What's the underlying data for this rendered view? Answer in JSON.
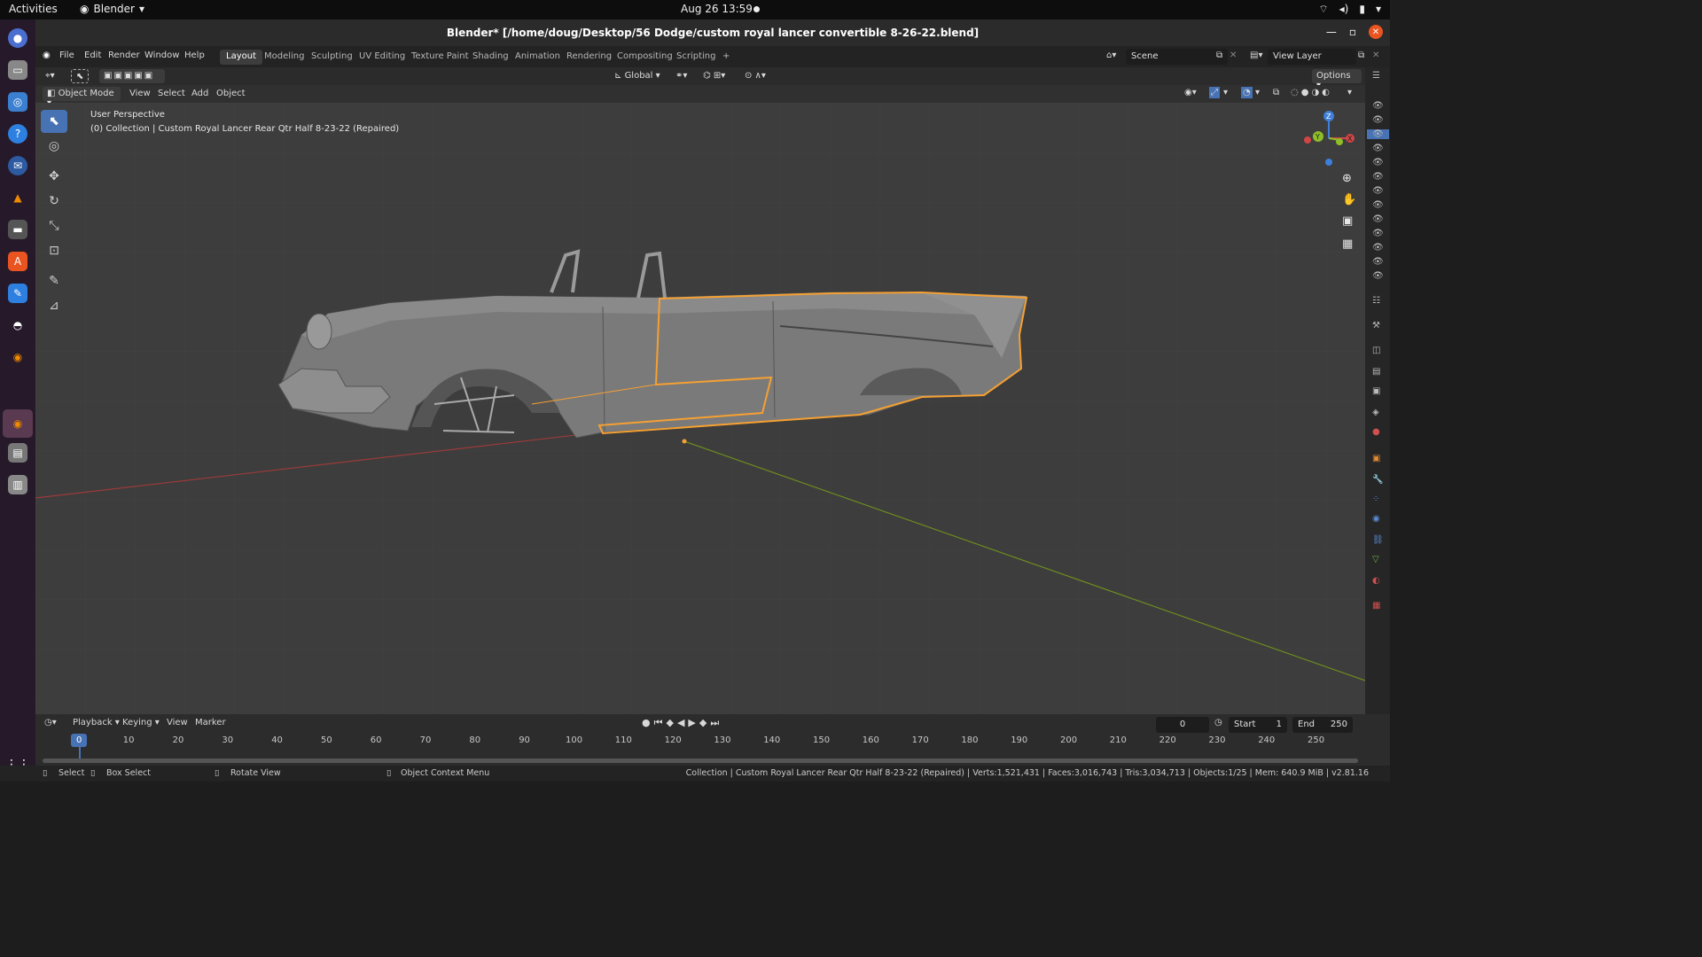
{
  "system_bar": {
    "activities": "Activities",
    "app_name": "Blender",
    "clock": "Aug 26  13:59"
  },
  "title": "Blender* [/home/doug/Desktop/56 Dodge/custom royal lancer convertible 8-26-22.blend]",
  "menu": [
    "File",
    "Edit",
    "Render",
    "Window",
    "Help"
  ],
  "workspaces": [
    "Layout",
    "Modeling",
    "Sculpting",
    "UV Editing",
    "Texture Paint",
    "Shading",
    "Animation",
    "Rendering",
    "Compositing",
    "Scripting"
  ],
  "active_workspace": "Layout",
  "scene": "Scene",
  "view_layer": "View Layer",
  "tool_header": {
    "transform_orientation": "Global",
    "options": "Options"
  },
  "viewport_header": {
    "mode": "Object Mode",
    "menus": [
      "View",
      "Select",
      "Add",
      "Object"
    ]
  },
  "viewport_overlay": {
    "perspective": "User Perspective",
    "collection": "(0) Collection | Custom Royal Lancer  Rear Qtr  Half 8-23-22 (Repaired)"
  },
  "gizmo": {
    "z": "Z",
    "y": "Y",
    "x": "X"
  },
  "timeline": {
    "menus": [
      "Playback",
      "Keying",
      "View",
      "Marker"
    ],
    "current_frame": "0",
    "start_label": "Start",
    "start": "1",
    "end_label": "End",
    "end": "250",
    "ticks": [
      "0",
      "10",
      "20",
      "30",
      "40",
      "50",
      "60",
      "70",
      "80",
      "90",
      "100",
      "110",
      "120",
      "130",
      "140",
      "150",
      "160",
      "170",
      "180",
      "190",
      "200",
      "210",
      "220",
      "230",
      "240",
      "250"
    ]
  },
  "status_bar": {
    "select": "Select",
    "box_select": "Box Select",
    "rotate_view": "Rotate View",
    "context_menu": "Object Context Menu",
    "stats": "Collection | Custom Royal Lancer  Rear Qtr  Half 8-23-22 (Repaired) | Verts:1,521,431 | Faces:3,016,743 | Tris:3,034,713 | Objects:1/25 | Mem: 640.9 MiB | v2.81.16"
  },
  "colors": {
    "accent": "#4772b3",
    "selection": "#f5a032",
    "x_axis": "#d04545",
    "y_axis": "#8dbd28",
    "z_axis": "#3d7fd9"
  },
  "icons": [
    "blender-icon",
    "chrome-icon",
    "files-icon",
    "help-icon",
    "rhythmbox-icon",
    "vlc-icon",
    "software-icon",
    "text-editor-icon",
    "gimp-icon",
    "trash-icon",
    "apps-grid-icon",
    "eye-icon",
    "cursor-icon",
    "move-icon",
    "rotate-icon",
    "scale-icon",
    "transform-icon",
    "annotate-icon",
    "measure-icon",
    "zoom-icon",
    "hand-icon",
    "camera-icon",
    "grid-icon"
  ]
}
